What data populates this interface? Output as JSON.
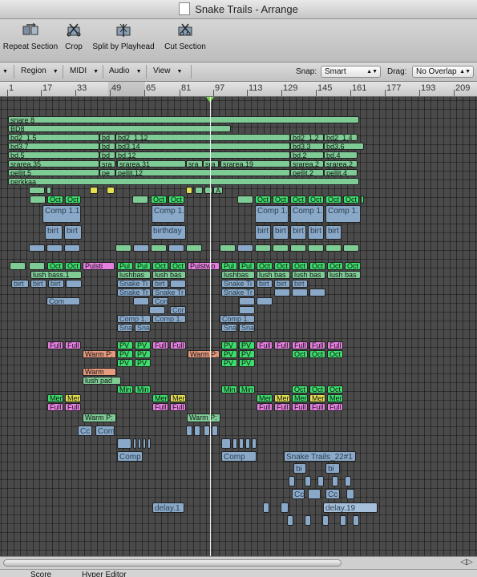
{
  "window": {
    "title": "Snake Trails - Arrange"
  },
  "toolbar": {
    "buttons": [
      "Repeat Section",
      "Crop",
      "Split by Playhead",
      "Cut Section"
    ]
  },
  "menubar": {
    "menus": [
      "Region",
      "MIDI",
      "Audio",
      "View"
    ],
    "snap_label": "Snap:",
    "snap_value": "Smart",
    "drag_label": "Drag:",
    "drag_value": "No Overlap"
  },
  "ruler": {
    "labels": [
      "1",
      "17",
      "33",
      "49",
      "65",
      "81",
      "97",
      "113",
      "129",
      "145",
      "161",
      "177",
      "193",
      "209"
    ]
  },
  "colors": {
    "green": "#7ecb95",
    "bright_green": "#3ddc6c",
    "blue": "#8aa9c9",
    "yellow": "#e3e052",
    "pink": "#e57fe0",
    "salmon": "#e69a7e",
    "light_blue": "#a6c0dc"
  },
  "icons": [
    "repeat-section-icon",
    "crop-icon",
    "split-by-playhead-icon",
    "cut-section-icon",
    "zoom-arrows-icon"
  ],
  "regions": [
    {
      "id": "r1",
      "label": "snare 8",
      "color": "green"
    },
    {
      "id": "r2",
      "label": "BD8",
      "color": "green"
    },
    {
      "id": "r3",
      "label": "bd2_1.5",
      "color": "green"
    },
    {
      "id": "r4",
      "label": "bd",
      "color": "green"
    },
    {
      "id": "r5",
      "label": "bd2_1.12",
      "color": "green"
    },
    {
      "id": "r6",
      "label": "bd2_1.2",
      "color": "green"
    },
    {
      "id": "r7",
      "label": "bd2_1.4",
      "color": "green"
    },
    {
      "id": "r8",
      "label": "bd3.7",
      "color": "green"
    },
    {
      "id": "r9",
      "label": "bd",
      "color": "green"
    },
    {
      "id": "r10",
      "label": "bd3.14",
      "color": "green"
    },
    {
      "id": "r11",
      "label": "bd3.3",
      "color": "green"
    },
    {
      "id": "r12",
      "label": "bd3.6",
      "color": "green"
    },
    {
      "id": "r13",
      "label": "bd.5",
      "color": "green"
    },
    {
      "id": "r14",
      "label": "bd",
      "color": "green"
    },
    {
      "id": "r15",
      "label": "bd.12",
      "color": "green"
    },
    {
      "id": "r16",
      "label": "bd.2",
      "color": "green"
    },
    {
      "id": "r17",
      "label": "bd.4",
      "color": "green"
    },
    {
      "id": "r18",
      "label": "srarea.35",
      "color": "green"
    },
    {
      "id": "r19",
      "label": "sra",
      "color": "green"
    },
    {
      "id": "r20",
      "label": "srarea.31",
      "color": "green"
    },
    {
      "id": "r21",
      "label": "sra",
      "color": "green"
    },
    {
      "id": "r22",
      "label": "sra",
      "color": "green"
    },
    {
      "id": "r23",
      "label": "srarea.19",
      "color": "green"
    },
    {
      "id": "r24",
      "label": "srarea.2",
      "color": "green"
    },
    {
      "id": "r25",
      "label": "srarea.2",
      "color": "green"
    },
    {
      "id": "r26",
      "label": "pellit.5",
      "color": "green"
    },
    {
      "id": "r27",
      "label": "pe",
      "color": "green"
    },
    {
      "id": "r28",
      "label": "pellit.12",
      "color": "green"
    },
    {
      "id": "r29",
      "label": "pellit.2",
      "color": "green"
    },
    {
      "id": "r30",
      "label": "pellit.4",
      "color": "green"
    },
    {
      "id": "r31",
      "label": "perkkaa",
      "color": "green"
    },
    {
      "id": "r32",
      "label": "A",
      "color": "green"
    },
    {
      "id": "r33",
      "label": "Oct",
      "color": "bright_green"
    },
    {
      "id": "r34",
      "label": "Oct",
      "color": "bright_green"
    },
    {
      "id": "r35",
      "label": "Oct",
      "color": "bright_green"
    },
    {
      "id": "r36",
      "label": "Oct",
      "color": "bright_green"
    },
    {
      "id": "r37",
      "label": "Oct",
      "color": "bright_green"
    },
    {
      "id": "r38",
      "label": "Oct",
      "color": "bright_green"
    },
    {
      "id": "r39",
      "label": "Oct",
      "color": "bright_green"
    },
    {
      "id": "r40",
      "label": "Oct",
      "color": "bright_green"
    },
    {
      "id": "r41",
      "label": "Oct",
      "color": "bright_green"
    },
    {
      "id": "r42",
      "label": "Oct",
      "color": "bright_green"
    },
    {
      "id": "r43",
      "label": "Oct",
      "color": "bright_green"
    },
    {
      "id": "r44",
      "label": "Comp 1.1",
      "color": "blue"
    },
    {
      "id": "r45",
      "label": "Comp 1.",
      "color": "blue"
    },
    {
      "id": "r46",
      "label": "Comp 1.",
      "color": "blue"
    },
    {
      "id": "r47",
      "label": "Comp 1.",
      "color": "blue"
    },
    {
      "id": "r48",
      "label": "Comp 1.",
      "color": "blue"
    },
    {
      "id": "r49",
      "label": "birt",
      "color": "blue"
    },
    {
      "id": "r50",
      "label": "birt",
      "color": "blue"
    },
    {
      "id": "r51",
      "label": "birthday",
      "color": "blue"
    },
    {
      "id": "r52",
      "label": "birt",
      "color": "blue"
    },
    {
      "id": "r53",
      "label": "birt",
      "color": "blue"
    },
    {
      "id": "r54",
      "label": "birt",
      "color": "blue"
    },
    {
      "id": "r55",
      "label": "birt",
      "color": "blue"
    },
    {
      "id": "r56",
      "label": "birt",
      "color": "blue"
    },
    {
      "id": "r57",
      "label": "Oct",
      "color": "bright_green"
    },
    {
      "id": "r58",
      "label": "Oct",
      "color": "bright_green"
    },
    {
      "id": "r59",
      "label": "Pulsti",
      "color": "pink"
    },
    {
      "id": "r60",
      "label": "Pul",
      "color": "bright_green"
    },
    {
      "id": "r61",
      "label": "Pul",
      "color": "bright_green"
    },
    {
      "id": "r62",
      "label": "Oct",
      "color": "bright_green"
    },
    {
      "id": "r63",
      "label": "Oct",
      "color": "bright_green"
    },
    {
      "id": "r64",
      "label": "Pulstwo",
      "color": "pink"
    },
    {
      "id": "r65",
      "label": "Pul",
      "color": "bright_green"
    },
    {
      "id": "r66",
      "label": "Pul",
      "color": "bright_green"
    },
    {
      "id": "r67",
      "label": "Oct",
      "color": "bright_green"
    },
    {
      "id": "r68",
      "label": "Oct",
      "color": "bright_green"
    },
    {
      "id": "r69",
      "label": "Oct",
      "color": "bright_green"
    },
    {
      "id": "r70",
      "label": "Oct",
      "color": "bright_green"
    },
    {
      "id": "r71",
      "label": "Oct",
      "color": "bright_green"
    },
    {
      "id": "r72",
      "label": "Oct",
      "color": "bright_green"
    },
    {
      "id": "r73",
      "label": "lush bass.1",
      "color": "green"
    },
    {
      "id": "r74",
      "label": "lushbas",
      "color": "green"
    },
    {
      "id": "r75",
      "label": "lush bas",
      "color": "green"
    },
    {
      "id": "r76",
      "label": "lushbas",
      "color": "green"
    },
    {
      "id": "r77",
      "label": "lush bas",
      "color": "green"
    },
    {
      "id": "r78",
      "label": "lush bas",
      "color": "green"
    },
    {
      "id": "r79",
      "label": "lush bas",
      "color": "green"
    },
    {
      "id": "r80",
      "label": "birt",
      "color": "blue"
    },
    {
      "id": "r81",
      "label": "birt",
      "color": "blue"
    },
    {
      "id": "r82",
      "label": "birt",
      "color": "blue"
    },
    {
      "id": "r83",
      "label": "Snake Ti",
      "color": "blue"
    },
    {
      "id": "r84",
      "label": "birt",
      "color": "blue"
    },
    {
      "id": "r85",
      "label": "Snake Ti",
      "color": "blue"
    },
    {
      "id": "r86",
      "label": "birt",
      "color": "blue"
    },
    {
      "id": "r87",
      "label": "birt",
      "color": "blue"
    },
    {
      "id": "r88",
      "label": "birt",
      "color": "blue"
    },
    {
      "id": "r89",
      "label": "Com",
      "color": "blue"
    },
    {
      "id": "r90",
      "label": "Snake Tr",
      "color": "blue"
    },
    {
      "id": "r91",
      "label": "Snake Tr",
      "color": "blue"
    },
    {
      "id": "r92",
      "label": "Snake Tr",
      "color": "blue"
    },
    {
      "id": "r93",
      "label": "Com",
      "color": "blue"
    },
    {
      "id": "r94",
      "label": "Cor",
      "color": "blue"
    },
    {
      "id": "r95",
      "label": "Comp 1.",
      "color": "blue"
    },
    {
      "id": "r96",
      "label": "Comp 1.",
      "color": "blue"
    },
    {
      "id": "r97",
      "label": "Comp 1.",
      "color": "blue"
    },
    {
      "id": "r98",
      "label": "Sna",
      "color": "blue"
    },
    {
      "id": "r99",
      "label": "Sna",
      "color": "blue"
    },
    {
      "id": "r100",
      "label": "Sna",
      "color": "blue"
    },
    {
      "id": "r101",
      "label": "Sna",
      "color": "blue"
    },
    {
      "id": "r102",
      "label": "Full",
      "color": "pink"
    },
    {
      "id": "r103",
      "label": "Full",
      "color": "pink"
    },
    {
      "id": "r104",
      "label": "PV",
      "color": "bright_green"
    },
    {
      "id": "r105",
      "label": "PV",
      "color": "bright_green"
    },
    {
      "id": "r106",
      "label": "Full",
      "color": "pink"
    },
    {
      "id": "r107",
      "label": "Full",
      "color": "pink"
    },
    {
      "id": "r108",
      "label": "PV",
      "color": "bright_green"
    },
    {
      "id": "r109",
      "label": "PV",
      "color": "bright_green"
    },
    {
      "id": "r110",
      "label": "Full",
      "color": "pink"
    },
    {
      "id": "r111",
      "label": "Full",
      "color": "pink"
    },
    {
      "id": "r112",
      "label": "Full",
      "color": "pink"
    },
    {
      "id": "r113",
      "label": "Full",
      "color": "pink"
    },
    {
      "id": "r114",
      "label": "Full",
      "color": "pink"
    },
    {
      "id": "r115",
      "label": "Warm P:",
      "color": "salmon"
    },
    {
      "id": "r116",
      "label": "PV",
      "color": "bright_green"
    },
    {
      "id": "r117",
      "label": "PV",
      "color": "bright_green"
    },
    {
      "id": "r118",
      "label": "Warm P:",
      "color": "salmon"
    },
    {
      "id": "r119",
      "label": "PV",
      "color": "bright_green"
    },
    {
      "id": "r120",
      "label": "PV",
      "color": "bright_green"
    },
    {
      "id": "r121",
      "label": "Oct",
      "color": "bright_green"
    },
    {
      "id": "r122",
      "label": "Oct",
      "color": "bright_green"
    },
    {
      "id": "r123",
      "label": "Oct",
      "color": "bright_green"
    },
    {
      "id": "r124",
      "label": "PV",
      "color": "bright_green"
    },
    {
      "id": "r125",
      "label": "PV",
      "color": "bright_green"
    },
    {
      "id": "r126",
      "label": "PV",
      "color": "bright_green"
    },
    {
      "id": "r127",
      "label": "PV",
      "color": "bright_green"
    },
    {
      "id": "r128",
      "label": "Warm",
      "color": "salmon"
    },
    {
      "id": "r129",
      "label": "lush pad",
      "color": "green"
    },
    {
      "id": "r130",
      "label": "Min",
      "color": "bright_green"
    },
    {
      "id": "r131",
      "label": "Min",
      "color": "bright_green"
    },
    {
      "id": "r132",
      "label": "Min",
      "color": "bright_green"
    },
    {
      "id": "r133",
      "label": "Min",
      "color": "bright_green"
    },
    {
      "id": "r134",
      "label": "Oct",
      "color": "bright_green"
    },
    {
      "id": "r135",
      "label": "Oct",
      "color": "bright_green"
    },
    {
      "id": "r136",
      "label": "Oct",
      "color": "bright_green"
    },
    {
      "id": "r137",
      "label": "Mer",
      "color": "bright_green"
    },
    {
      "id": "r138",
      "label": "Mer",
      "color": "yellow"
    },
    {
      "id": "r139",
      "label": "Mer",
      "color": "bright_green"
    },
    {
      "id": "r140",
      "label": "Mer",
      "color": "yellow"
    },
    {
      "id": "r141",
      "label": "Mer",
      "color": "bright_green"
    },
    {
      "id": "r142",
      "label": "Mer",
      "color": "yellow"
    },
    {
      "id": "r143",
      "label": "Mer",
      "color": "bright_green"
    },
    {
      "id": "r144",
      "label": "Mer",
      "color": "yellow"
    },
    {
      "id": "r145",
      "label": "Mer",
      "color": "bright_green"
    },
    {
      "id": "r146",
      "label": "Full",
      "color": "pink"
    },
    {
      "id": "r147",
      "label": "Full",
      "color": "pink"
    },
    {
      "id": "r148",
      "label": "Full",
      "color": "pink"
    },
    {
      "id": "r149",
      "label": "Full",
      "color": "pink"
    },
    {
      "id": "r150",
      "label": "Full",
      "color": "pink"
    },
    {
      "id": "r151",
      "label": "Full",
      "color": "pink"
    },
    {
      "id": "r152",
      "label": "Full",
      "color": "pink"
    },
    {
      "id": "r153",
      "label": "Full",
      "color": "pink"
    },
    {
      "id": "r154",
      "label": "Full",
      "color": "pink"
    },
    {
      "id": "r155",
      "label": "Warm P:",
      "color": "green"
    },
    {
      "id": "r156",
      "label": "Warm P:",
      "color": "green"
    },
    {
      "id": "r157",
      "label": "Cc",
      "color": "blue"
    },
    {
      "id": "r158",
      "label": "Com",
      "color": "blue"
    },
    {
      "id": "r159",
      "label": "Comp",
      "color": "blue"
    },
    {
      "id": "r160",
      "label": "Comp",
      "color": "blue"
    },
    {
      "id": "r161",
      "label": "Snake Trails_22#1",
      "color": "blue"
    },
    {
      "id": "r162",
      "label": "bi",
      "color": "blue"
    },
    {
      "id": "r163",
      "label": "bi",
      "color": "blue"
    },
    {
      "id": "r164",
      "label": "Cc",
      "color": "blue"
    },
    {
      "id": "r165",
      "label": "Cc",
      "color": "blue"
    },
    {
      "id": "r166",
      "label": "delay.1",
      "color": "blue"
    },
    {
      "id": "r167",
      "label": "delay.19",
      "color": "light_blue"
    }
  ],
  "bottom_tabs": [
    "Score",
    "Hyper Editor"
  ]
}
